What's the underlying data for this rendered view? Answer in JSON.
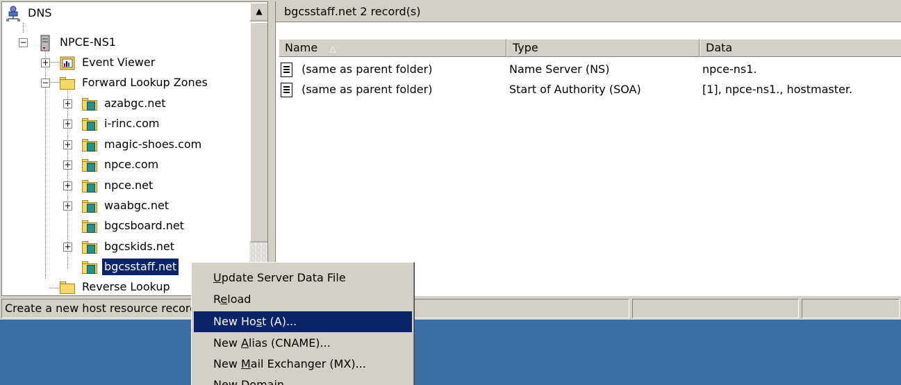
{
  "tree": {
    "root": "DNS",
    "server": "NPCE-NS1",
    "event_viewer": "Event Viewer",
    "forward_zones": "Forward Lookup Zones",
    "zones": [
      {
        "label": "azabgc.net"
      },
      {
        "label": "i-rinc.com"
      },
      {
        "label": "magic-shoes.com"
      },
      {
        "label": "npce.com"
      },
      {
        "label": "npce.net"
      },
      {
        "label": "waabgc.net"
      },
      {
        "label": "bgcsboard.net"
      },
      {
        "label": "bgcskids.net"
      },
      {
        "label": "bgcsstaff.net"
      }
    ],
    "reverse_zones": "Reverse Lookup"
  },
  "details": {
    "header": "bgcsstaff.net   2 record(s)",
    "columns": [
      "Name",
      "Type",
      "Data"
    ],
    "rows": [
      {
        "name": "(same as parent folder)",
        "type": "Name Server (NS)",
        "data": "npce-ns1."
      },
      {
        "name": "(same as parent folder)",
        "type": "Start of Authority (SOA)",
        "data": "[1], npce-ns1., hostmaster."
      }
    ]
  },
  "status": {
    "text": "Create a new host resource record."
  },
  "context_menu": {
    "items": [
      {
        "pre": "",
        "key": "U",
        "post": "pdate Server Data File"
      },
      {
        "pre": "R",
        "key": "e",
        "post": "load"
      },
      {
        "pre": "New Ho",
        "key": "s",
        "post": "t (A)..."
      },
      {
        "pre": "New ",
        "key": "A",
        "post": "lias (CNAME)..."
      },
      {
        "pre": "New ",
        "key": "M",
        "post": "ail Exchanger (MX)..."
      },
      {
        "pre": "New Domain",
        "key": "",
        "post": ""
      }
    ],
    "highlighted_index": 2
  },
  "colors": {
    "desktop": "#3a6ea5",
    "selection": "#0a246a",
    "window": "#d4d0c8"
  }
}
